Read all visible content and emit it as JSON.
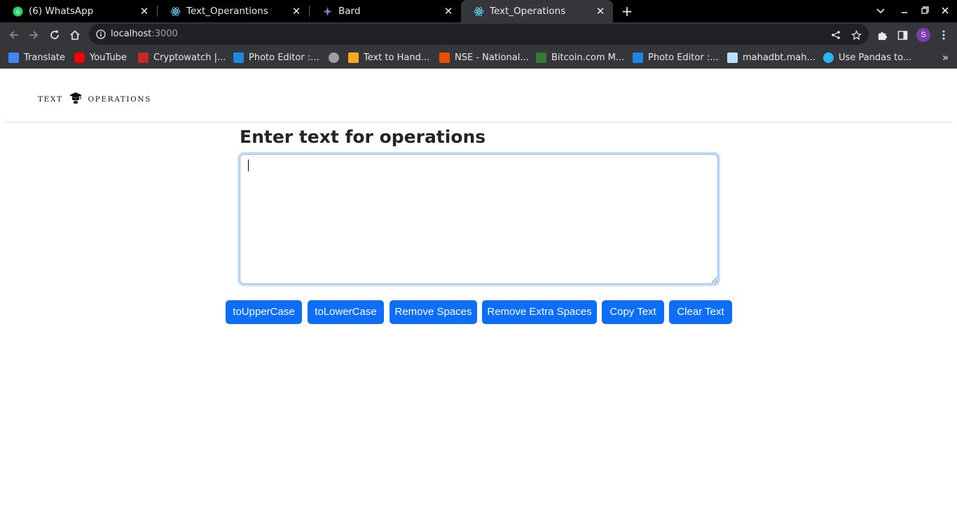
{
  "browser": {
    "tabs": [
      {
        "title": "(6) WhatsApp",
        "icon": "whatsapp-icon",
        "badge": "6",
        "active": false
      },
      {
        "title": "Text_Operantions",
        "icon": "react-icon",
        "active": false
      },
      {
        "title": "Bard",
        "icon": "bard-icon",
        "active": false
      },
      {
        "title": "Text_Operations",
        "icon": "react-icon",
        "active": true
      }
    ],
    "address": {
      "host": "localhost",
      "port": ":3000"
    },
    "profile_initial": "S",
    "bookmarks": [
      {
        "label": "Translate",
        "icon": "google-translate-icon",
        "color": "#4285f4"
      },
      {
        "label": "YouTube",
        "icon": "youtube-icon",
        "color": "#ff0000"
      },
      {
        "label": "Cryptowatch |...",
        "icon": "cryptowatch-icon",
        "color": "#c62828"
      },
      {
        "label": "Photo Editor :...",
        "icon": "photo-editor-icon",
        "color": "#1e88e5"
      },
      {
        "label": "",
        "icon": "globe-icon",
        "color": "#9aa0a6"
      },
      {
        "label": "Text to Hand...",
        "icon": "handwriting-icon",
        "color": "#f9a825"
      },
      {
        "label": "NSE - National...",
        "icon": "nse-icon",
        "color": "#e65100"
      },
      {
        "label": "Bitcoin.com M...",
        "icon": "bitcoin-icon",
        "color": "#2e7d32"
      },
      {
        "label": "Photo Editor :...",
        "icon": "photo-editor-icon",
        "color": "#1e88e5"
      },
      {
        "label": "mahadbt.mah...",
        "icon": "document-icon",
        "color": "#bbdefb"
      },
      {
        "label": "Use Pandas to...",
        "icon": "pandas-icon",
        "color": "#29b6f6"
      }
    ]
  },
  "app": {
    "logo_left": "TEXT",
    "logo_right": "OPERATIONS",
    "heading": "Enter text for operations",
    "textarea_value": "",
    "buttons": [
      {
        "label": "toUpperCase"
      },
      {
        "label": "toLowerCase"
      },
      {
        "label": "Remove Spaces"
      },
      {
        "label": "Remove Extra Spaces"
      },
      {
        "label": "Copy Text"
      },
      {
        "label": "Clear Text"
      }
    ],
    "accent_color": "#0d6efd"
  }
}
